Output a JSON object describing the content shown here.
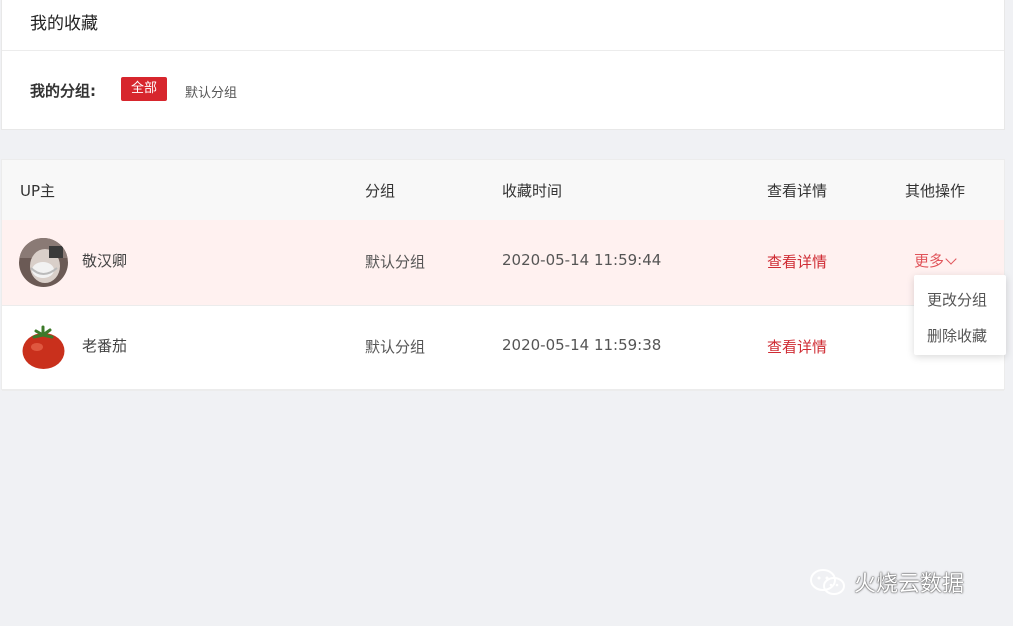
{
  "page": {
    "title": "我的收藏"
  },
  "groups": {
    "label": "我的分组:",
    "items": [
      {
        "label": "全部",
        "active": true
      },
      {
        "label": "默认分组",
        "active": false
      }
    ]
  },
  "table": {
    "columns": [
      "UP主",
      "分组",
      "收藏时间",
      "查看详情",
      "其他操作"
    ],
    "rows": [
      {
        "name": "敬汉卿",
        "group": "默认分组",
        "time": "2020-05-14 11:59:44",
        "detail": "查看详情",
        "more": "更多",
        "avatar": "person-avatar"
      },
      {
        "name": "老番茄",
        "group": "默认分组",
        "time": "2020-05-14 11:59:38",
        "detail": "查看详情",
        "more": "",
        "avatar": "tomato-avatar"
      }
    ]
  },
  "dropdown": {
    "items": [
      "更改分组",
      "删除收藏"
    ]
  },
  "watermark": {
    "text": "火烧云数据",
    "icon": "wechat-icon"
  },
  "colors": {
    "accent": "#d7262d",
    "link": "#cf2b33",
    "highlight_row": "#fff1f0",
    "background": "#f0f1f4"
  }
}
